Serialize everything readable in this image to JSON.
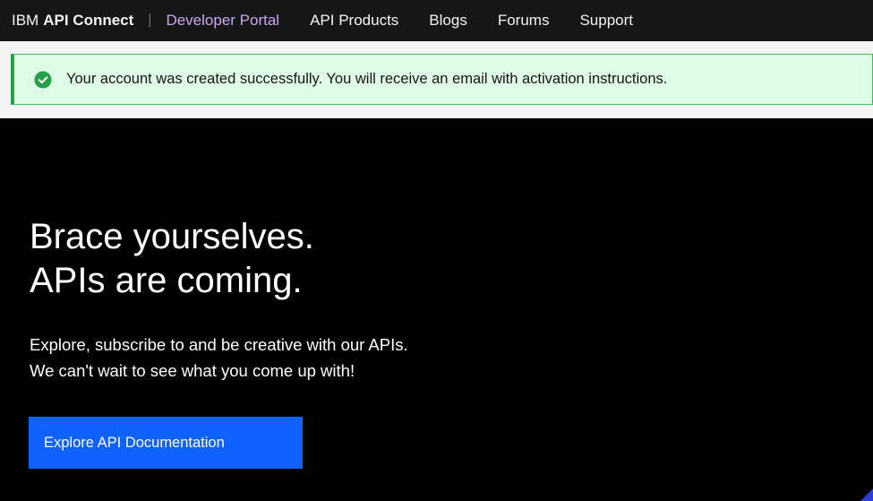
{
  "header": {
    "brand_prefix": "IBM",
    "brand_product": "API Connect",
    "divider": "|",
    "nav": [
      {
        "label": "Developer Portal",
        "active": true
      },
      {
        "label": "API Products"
      },
      {
        "label": "Blogs"
      },
      {
        "label": "Forums"
      },
      {
        "label": "Support"
      }
    ]
  },
  "notification": {
    "icon": "checkmark-filled-icon",
    "kind": "success",
    "message": "Your account was created successfully. You will receive an email with activation instructions."
  },
  "hero": {
    "title_line1": "Brace yourselves.",
    "title_line2": "APIs are coming.",
    "subtitle_line1": "Explore, subscribe to and be creative with our APIs.",
    "subtitle_line2": "We can't wait to see what you come up with!",
    "cta_label": "Explore API Documentation"
  },
  "colors": {
    "header_bg": "#161616",
    "active_nav": "#c6a7f2",
    "success_bg": "#defbe6",
    "success_border": "#24a148",
    "hero_bg": "#000000",
    "primary_button": "#0f62fe"
  }
}
